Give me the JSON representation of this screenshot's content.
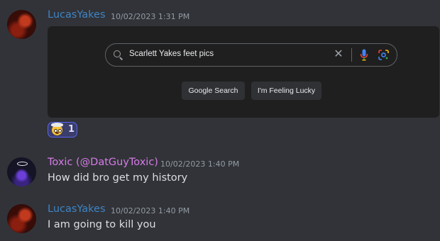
{
  "messages": [
    {
      "username": "LucasYakes",
      "timestamp": "10/02/2023 1:31 PM",
      "embed": {
        "search_query": "Scarlett Yakes feet pics",
        "google_search_label": "Google Search",
        "feeling_lucky_label": "I'm Feeling Lucky"
      },
      "reaction": {
        "emoji": "exploding-head-emoji",
        "count": "1"
      }
    },
    {
      "username": "Toxic (@DatGuyToxic)",
      "timestamp": "10/02/2023 1:40 PM",
      "content": "How did bro get my history"
    },
    {
      "username": "LucasYakes",
      "timestamp": "10/02/2023 1:40 PM",
      "content": "I am going to kill you"
    }
  ],
  "colors": {
    "background": "#313338",
    "lucas_name": "#3f84c4",
    "toxic_name": "#d77be8",
    "reaction_border": "#5865f2"
  }
}
